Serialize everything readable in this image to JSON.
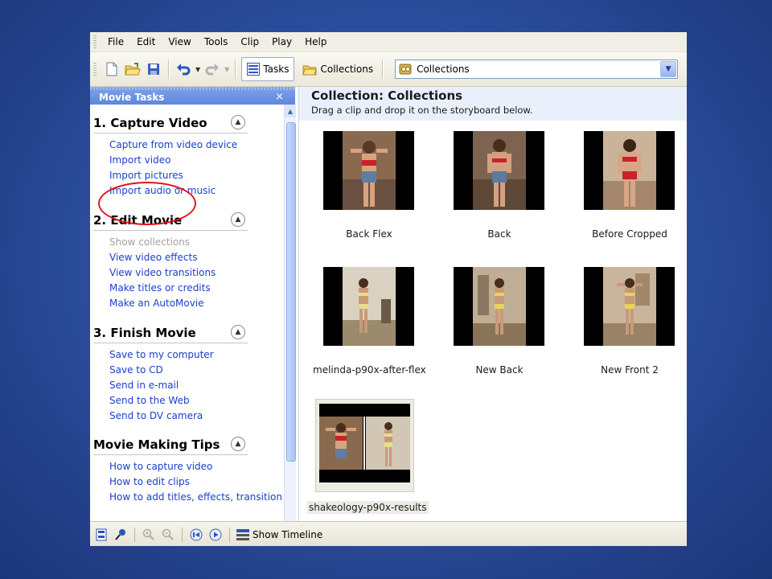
{
  "menu": {
    "items": [
      {
        "label": "File"
      },
      {
        "label": "Edit"
      },
      {
        "label": "View"
      },
      {
        "label": "Tools"
      },
      {
        "label": "Clip"
      },
      {
        "label": "Play"
      },
      {
        "label": "Help"
      }
    ]
  },
  "toolbar": {
    "tasks_label": "Tasks",
    "collections_label": "Collections",
    "collection_select_value": "Collections"
  },
  "taskpane": {
    "title": "Movie Tasks",
    "close_glyph": "×",
    "sections": [
      {
        "title": "1. Capture Video",
        "links": [
          "Capture from video device",
          "Import video",
          "Import pictures",
          "Import audio or music"
        ]
      },
      {
        "title": "2. Edit Movie",
        "links": [
          "Show collections",
          "View video effects",
          "View video transitions",
          "Make titles or credits",
          "Make an AutoMovie"
        ]
      },
      {
        "title": "3. Finish Movie",
        "links": [
          "Save to my computer",
          "Save to CD",
          "Send in e-mail",
          "Send to the Web",
          "Send to DV camera"
        ]
      },
      {
        "title": "Movie Making Tips",
        "links": [
          "How to capture video",
          "How to edit clips",
          "How to add titles, effects, transitions"
        ]
      }
    ]
  },
  "collection": {
    "title": "Collection: Collections",
    "subtitle": "Drag a clip and drop it on the storyboard below.",
    "clips": [
      {
        "label": "Back Flex"
      },
      {
        "label": "Back"
      },
      {
        "label": "Before Cropped"
      },
      {
        "label": "melinda-p90x-after-flex"
      },
      {
        "label": "New Back"
      },
      {
        "label": "New Front 2"
      },
      {
        "label": "shakeology-p90x-results"
      }
    ]
  },
  "bottombar": {
    "show_timeline_label": "Show Timeline"
  },
  "colors": {
    "background": "#2a4c9a",
    "link": "#1a3fc9",
    "highlight_ellipse": "#e0141b",
    "pane_header": "#6c93e2"
  }
}
